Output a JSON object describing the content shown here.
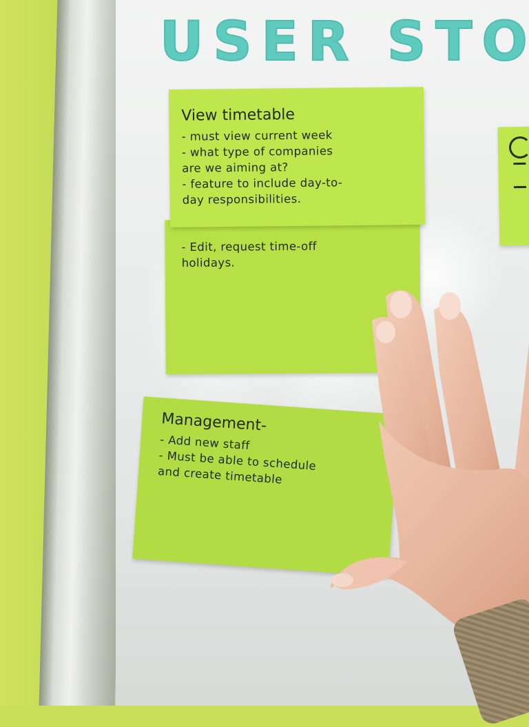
{
  "board": {
    "title": "USER STO"
  },
  "notes": {
    "view_timetable": {
      "title": "View timetable",
      "items": [
        "- must view current week",
        "- what type of companies",
        "are we aiming at?",
        "- feature to include day-to-",
        "day responsibilities."
      ]
    },
    "edit": {
      "items": [
        "- Edit, request time-off",
        "holidays."
      ]
    },
    "management": {
      "title": "Management-",
      "items": [
        "- Add new staff",
        "- Must be able to schedule",
        "and create timetable"
      ]
    }
  },
  "colors": {
    "sticky_note": "#b9e34a",
    "marker": "#4fc7b9",
    "wall": "#c9df5a",
    "whiteboard": "#eceeed"
  },
  "objects": [
    "hand-photo",
    "sleeve"
  ]
}
